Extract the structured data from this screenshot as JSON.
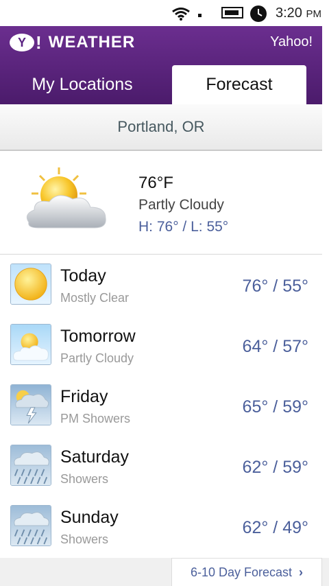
{
  "status_bar": {
    "time": "3:20",
    "ampm": "PM"
  },
  "header": {
    "logo_text": "Y!",
    "app_title": "WEATHER",
    "brand": "Yahoo!"
  },
  "tabs": [
    {
      "label": "My Locations",
      "active": false
    },
    {
      "label": "Forecast",
      "active": true
    }
  ],
  "location": "Portland, OR",
  "current": {
    "temp": "76°F",
    "condition": "Partly Cloudy",
    "hi_lo": "H: 76° / L: 55°",
    "icon": "partly-cloudy-icon"
  },
  "forecast": [
    {
      "day": "Today",
      "condition": "Mostly Clear",
      "temps": "76° / 55°",
      "icon": "sun-icon"
    },
    {
      "day": "Tomorrow",
      "condition": "Partly Cloudy",
      "temps": "64° / 57°",
      "icon": "partly-cloudy-icon"
    },
    {
      "day": "Friday",
      "condition": "PM Showers",
      "temps": "65° / 59°",
      "icon": "thunder-showers-icon"
    },
    {
      "day": "Saturday",
      "condition": "Showers",
      "temps": "62° / 59°",
      "icon": "rain-icon"
    },
    {
      "day": "Sunday",
      "condition": "Showers",
      "temps": "62° / 49°",
      "icon": "rain-icon"
    }
  ],
  "footer": {
    "link_label": "6-10 Day Forecast"
  },
  "colors": {
    "header": "#5a2382",
    "accent_blue": "#4b5f9b"
  }
}
